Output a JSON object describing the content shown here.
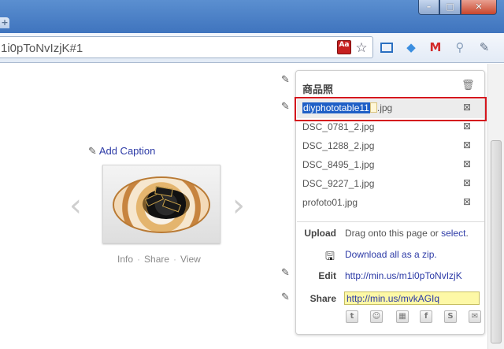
{
  "browser": {
    "new_tab": "+",
    "window_controls": {
      "minimize": "–",
      "maximize": "□",
      "close": "✕"
    },
    "url": "1i0pToNvIzjK#1",
    "icons": [
      "pdf-icon",
      "star-icon",
      "capture-icon",
      "bird-icon",
      "gmail-icon",
      "search-icon",
      "wrench-icon"
    ]
  },
  "gallery": {
    "add_caption": "Add Caption",
    "prev_arrow": "‹",
    "next_arrow": "›",
    "actions": {
      "info": "Info",
      "share": "Share",
      "view": "View",
      "separator": "·"
    }
  },
  "panel": {
    "title": "商品照",
    "files": [
      {
        "selected_text": "diyphototable11",
        "rest": ".jpg",
        "editing": true
      },
      {
        "name": "DSC_0781_2.jpg"
      },
      {
        "name": "DSC_1288_2.jpg"
      },
      {
        "name": "DSC_8495_1.jpg"
      },
      {
        "name": "DSC_9227_1.jpg"
      },
      {
        "name": "profoto01.jpg"
      }
    ],
    "upload_label": "Upload",
    "upload_text": "Drag onto this page or",
    "upload_link": "select",
    "upload_end": ".",
    "download_link": "Download all as a zip.",
    "edit_label": "Edit",
    "edit_url": "http://min.us/m1i0pToNvIzjK",
    "share_label": "Share",
    "share_url": "http://min.us/mvkAGIq",
    "social_icons": [
      "twitter-icon",
      "myspace-icon",
      "delicious-icon",
      "facebook-icon",
      "stumbleupon-icon",
      "email-icon"
    ]
  },
  "colors": {
    "link": "#2c3aa6",
    "selection": "#1f5fc6",
    "highlight_box": "#d4161d",
    "share_field": "#fdf8a6"
  }
}
